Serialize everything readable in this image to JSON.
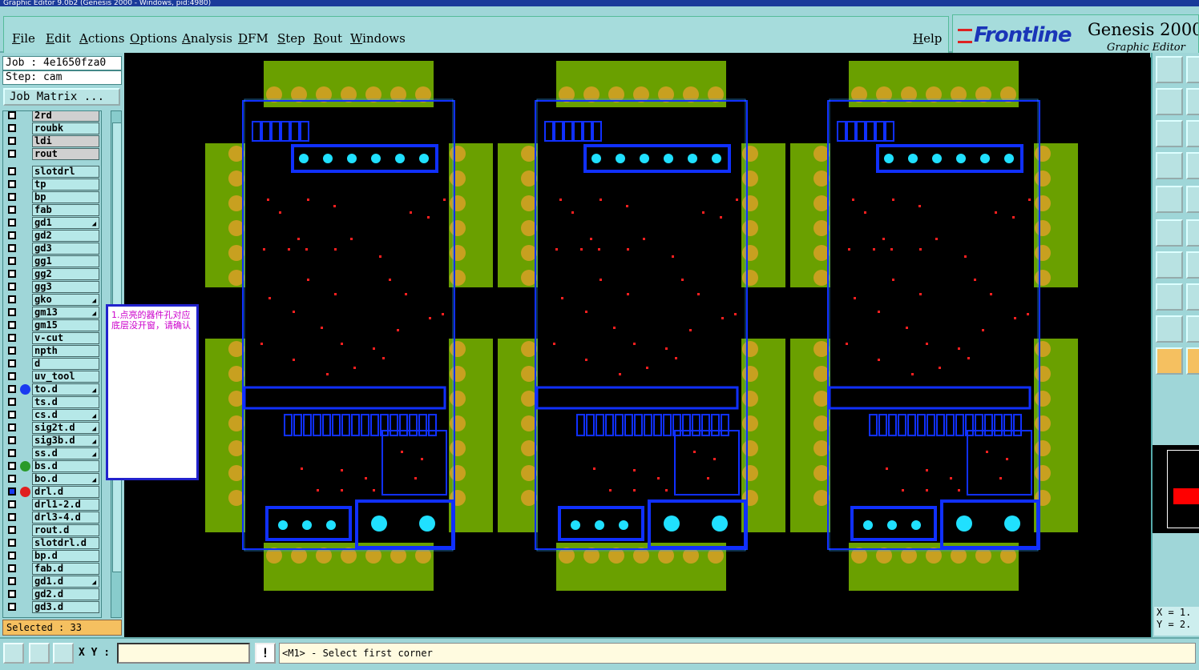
{
  "window": {
    "title": "Graphic Editor 9.0b2 (Genesis 2000 - Windows, pid:4980)"
  },
  "menu": {
    "items": [
      "File",
      "Edit",
      "Actions",
      "Options",
      "Analysis",
      "DFM",
      "Step",
      "Rout",
      "Windows"
    ],
    "help": "Help"
  },
  "brand": {
    "logo": "Frontline",
    "product": "Genesis 2000",
    "subtitle": "Graphic Editor"
  },
  "job": {
    "label": "Job : 4e1650fza0",
    "step": "Step: cam",
    "matrix_button": "Job Matrix ..."
  },
  "layers": [
    {
      "name": "2rd",
      "gray": true
    },
    {
      "name": "roubk"
    },
    {
      "name": "ldi",
      "gray": true
    },
    {
      "name": "rout",
      "gray": true
    },
    {
      "name": "slotdrl"
    },
    {
      "name": "tp"
    },
    {
      "name": "bp"
    },
    {
      "name": "fab"
    },
    {
      "name": "gd1",
      "flag": true
    },
    {
      "name": "gd2"
    },
    {
      "name": "gd3"
    },
    {
      "name": "gg1"
    },
    {
      "name": "gg2"
    },
    {
      "name": "gg3"
    },
    {
      "name": "gko",
      "flag": true
    },
    {
      "name": "gm13",
      "flag": true
    },
    {
      "name": "gm15"
    },
    {
      "name": "v-cut"
    },
    {
      "name": "npth"
    },
    {
      "name": "d"
    },
    {
      "name": "uv_tool"
    },
    {
      "name": "to.d",
      "color": "#1a3af0",
      "flag": true
    },
    {
      "name": "ts.d"
    },
    {
      "name": "cs.d",
      "flag": true
    },
    {
      "name": "sig2t.d",
      "flag": true
    },
    {
      "name": "sig3b.d",
      "flag": true
    },
    {
      "name": "ss.d",
      "flag": true
    },
    {
      "name": "bs.d",
      "color": "#2a9a2a"
    },
    {
      "name": "bo.d",
      "flag": true
    },
    {
      "name": "drl.d",
      "color": "#e02020",
      "work": true
    },
    {
      "name": "drl1-2.d"
    },
    {
      "name": "drl3-4.d"
    },
    {
      "name": "rout.d"
    },
    {
      "name": "slotdrl.d"
    },
    {
      "name": "bp.d"
    },
    {
      "name": "fab.d"
    },
    {
      "name": "gd1.d",
      "flag": true
    },
    {
      "name": "gd2.d"
    },
    {
      "name": "gd3.d"
    }
  ],
  "selected": "Selected : 33",
  "note": "1.点亮的器件孔对应底层没开窗，请确认",
  "coords": {
    "x": "X = 1.",
    "y": "Y = 2."
  },
  "status": {
    "xy_label": "X Y :",
    "xy_value": "",
    "prompt": "<M1> - Select first corner"
  },
  "colors": {
    "pad": "#6aa000",
    "padring": "#c8a020",
    "outline": "#1030ff",
    "drill": "#ff2020",
    "hole": "#20e0ff"
  }
}
